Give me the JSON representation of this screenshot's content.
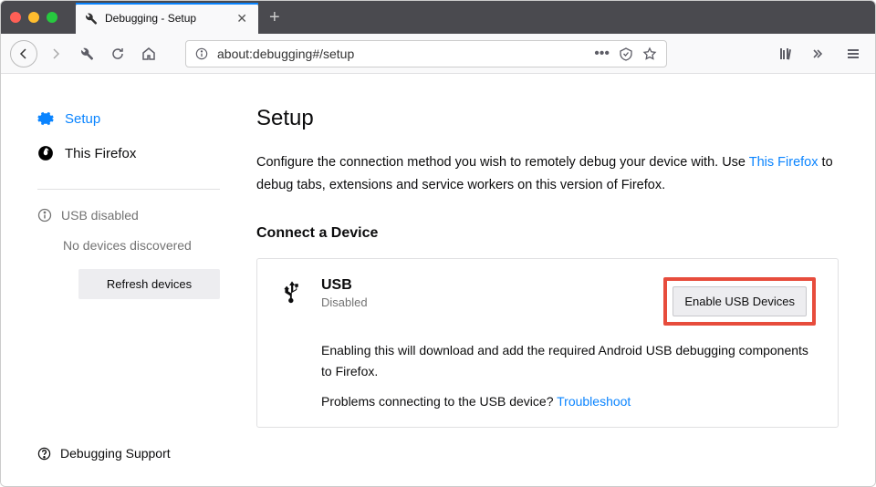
{
  "tab": {
    "title": "Debugging - Setup"
  },
  "urlbar": {
    "value": "about:debugging#/setup"
  },
  "sidebar": {
    "setup": "Setup",
    "this_firefox": "This Firefox",
    "usb_status": "USB disabled",
    "no_devices": "No devices discovered",
    "refresh": "Refresh devices",
    "support": "Debugging Support"
  },
  "main": {
    "title": "Setup",
    "intro_pre": "Configure the connection method you wish to remotely debug your device with. Use ",
    "intro_link": "This Firefox",
    "intro_post": " to debug tabs, extensions and service workers on this version of Firefox.",
    "connect_title": "Connect a Device",
    "usb": {
      "title": "USB",
      "status": "Disabled",
      "enable_btn": "Enable USB Devices",
      "desc": "Enabling this will download and add the required Android USB debugging components to Firefox.",
      "help_pre": "Problems connecting to the USB device? ",
      "help_link": "Troubleshoot"
    }
  }
}
